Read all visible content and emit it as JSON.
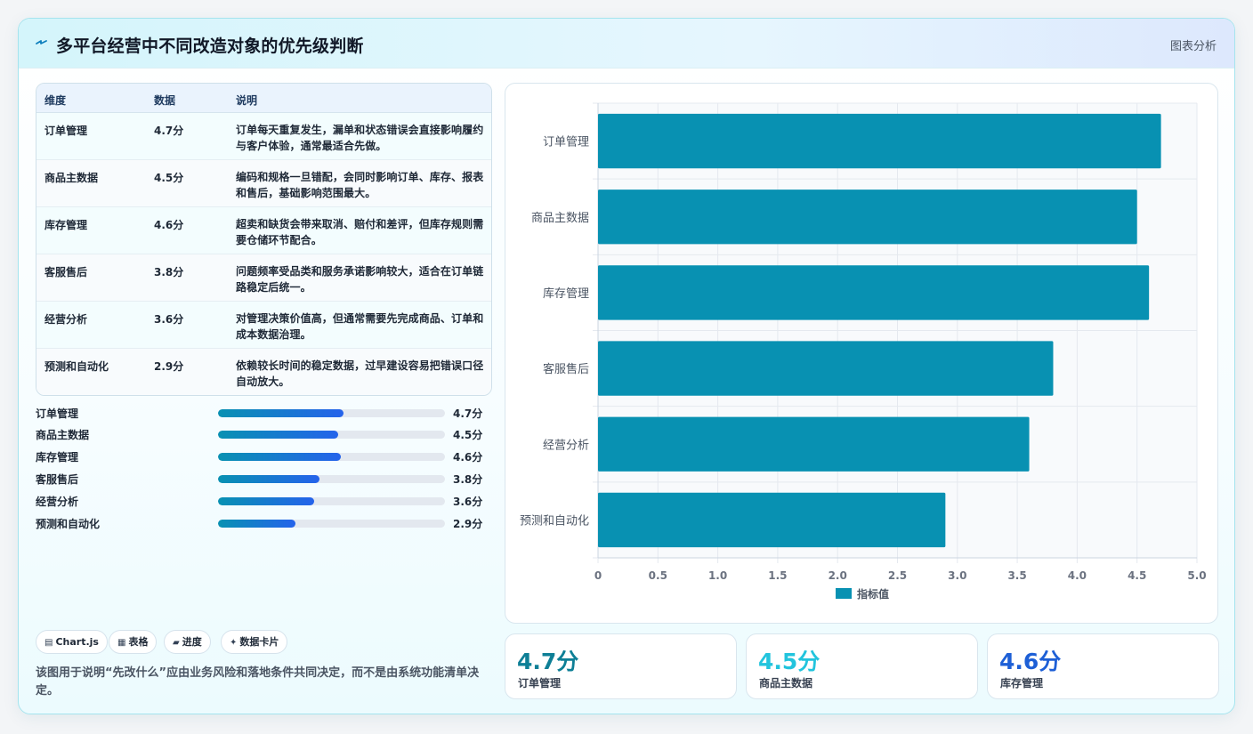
{
  "header": {
    "title": "多平台经营中不同改造对象的优先级判断",
    "tag": "图表分析"
  },
  "table": {
    "columns": [
      "维度",
      "数据",
      "说明"
    ],
    "rows": [
      {
        "name": "订单管理",
        "score": "4.7分",
        "desc": "订单每天重复发生，漏单和状态错误会直接影响履约与客户体验，通常最适合先做。"
      },
      {
        "name": "商品主数据",
        "score": "4.5分",
        "desc": "编码和规格一旦错配，会同时影响订单、库存、报表和售后，基础影响范围最大。"
      },
      {
        "name": "库存管理",
        "score": "4.6分",
        "desc": "超卖和缺货会带来取消、赔付和差评，但库存规则需要仓储环节配合。"
      },
      {
        "name": "客服售后",
        "score": "3.8分",
        "desc": "问题频率受品类和服务承诺影响较大，适合在订单链路稳定后统一。"
      },
      {
        "name": "经营分析",
        "score": "3.6分",
        "desc": "对管理决策价值高，但通常需要先完成商品、订单和成本数据治理。"
      },
      {
        "name": "预测和自动化",
        "score": "2.9分",
        "desc": "依赖较长时间的稳定数据，过早建设容易把错误口径自动放大。"
      }
    ]
  },
  "progress": [
    {
      "label": "订单管理",
      "value": 4.7,
      "text": "4.7分"
    },
    {
      "label": "商品主数据",
      "value": 4.5,
      "text": "4.5分"
    },
    {
      "label": "库存管理",
      "value": 4.6,
      "text": "4.6分"
    },
    {
      "label": "客服售后",
      "value": 3.8,
      "text": "3.8分"
    },
    {
      "label": "经营分析",
      "value": 3.6,
      "text": "3.6分"
    },
    {
      "label": "预测和自动化",
      "value": 2.9,
      "text": "2.9分"
    }
  ],
  "progress_max": 8.5,
  "chips": [
    {
      "icon": "▤",
      "label": "Chart.js"
    },
    {
      "icon": "▦",
      "label": "表格"
    },
    {
      "icon": "▰",
      "label": "进度"
    },
    {
      "icon": "✦",
      "label": "数据卡片"
    }
  ],
  "note": "该图用于说明“先改什么”应由业务风险和落地条件共同决定，而不是由系统功能清单决定。",
  "stats": [
    {
      "value": "4.7分",
      "label": "订单管理",
      "color": "#0e7f96"
    },
    {
      "value": "4.5分",
      "label": "商品主数据",
      "color": "#22c4dd"
    },
    {
      "value": "4.6分",
      "label": "库存管理",
      "color": "#1d5fd6"
    }
  ],
  "colors": {
    "bar": "#0891b2",
    "accent_gradient_start": "#0891b2",
    "accent_gradient_end": "#2563eb"
  },
  "chart_data": {
    "type": "bar",
    "orientation": "horizontal",
    "categories": [
      "订单管理",
      "商品主数据",
      "库存管理",
      "客服售后",
      "经营分析",
      "预测和自动化"
    ],
    "series": [
      {
        "name": "指标值",
        "values": [
          4.7,
          4.5,
          4.6,
          3.8,
          3.6,
          2.9
        ]
      }
    ],
    "xlim": [
      0,
      5.0
    ],
    "xticks": [
      "0",
      "0.5",
      "1.0",
      "1.5",
      "2.0",
      "2.5",
      "3.0",
      "3.5",
      "4.0",
      "4.5",
      "5.0"
    ],
    "grid": true,
    "legend_position": "bottom"
  }
}
